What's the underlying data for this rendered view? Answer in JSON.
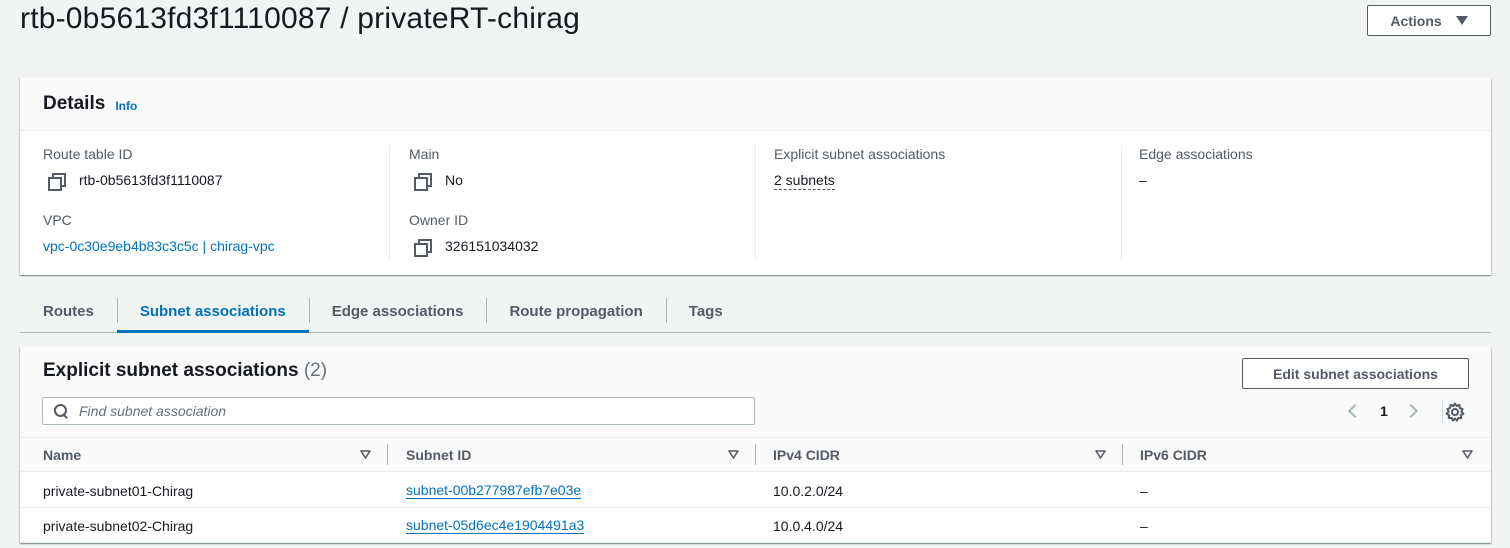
{
  "header": {
    "title": "rtb-0b5613fd3f1110087 / privateRT-chirag",
    "actions_label": "Actions"
  },
  "details": {
    "title": "Details",
    "info_label": "Info",
    "route_table_id_label": "Route table ID",
    "route_table_id": "rtb-0b5613fd3f1110087",
    "vpc_label": "VPC",
    "vpc_value": "vpc-0c30e9eb4b83c3c5c | chirag-vpc",
    "main_label": "Main",
    "main_value": "No",
    "owner_id_label": "Owner ID",
    "owner_id": "326151034032",
    "explicit_label": "Explicit subnet associations",
    "explicit_value": "2 subnets",
    "edge_label": "Edge associations",
    "edge_value": "–"
  },
  "tabs": [
    {
      "label": "Routes"
    },
    {
      "label": "Subnet associations"
    },
    {
      "label": "Edge associations"
    },
    {
      "label": "Route propagation"
    },
    {
      "label": "Tags"
    }
  ],
  "subnet_panel": {
    "title": "Explicit subnet associations",
    "count": "(2)",
    "edit_label": "Edit subnet associations",
    "search_placeholder": "Find subnet association",
    "page": "1",
    "columns": [
      "Name",
      "Subnet ID",
      "IPv4 CIDR",
      "IPv6 CIDR"
    ],
    "rows": [
      {
        "name": "private-subnet01-Chirag",
        "subnet_id": "subnet-00b277987efb7e03e",
        "ipv4": "10.0.2.0/24",
        "ipv6": "–"
      },
      {
        "name": "private-subnet02-Chirag",
        "subnet_id": "subnet-05d6ec4e1904491a3",
        "ipv4": "10.0.4.0/24",
        "ipv6": "–"
      }
    ]
  },
  "colors": {
    "link": "#0073bb",
    "text": "#16191f",
    "muted": "#545b64",
    "background": "#f2f3f3"
  }
}
